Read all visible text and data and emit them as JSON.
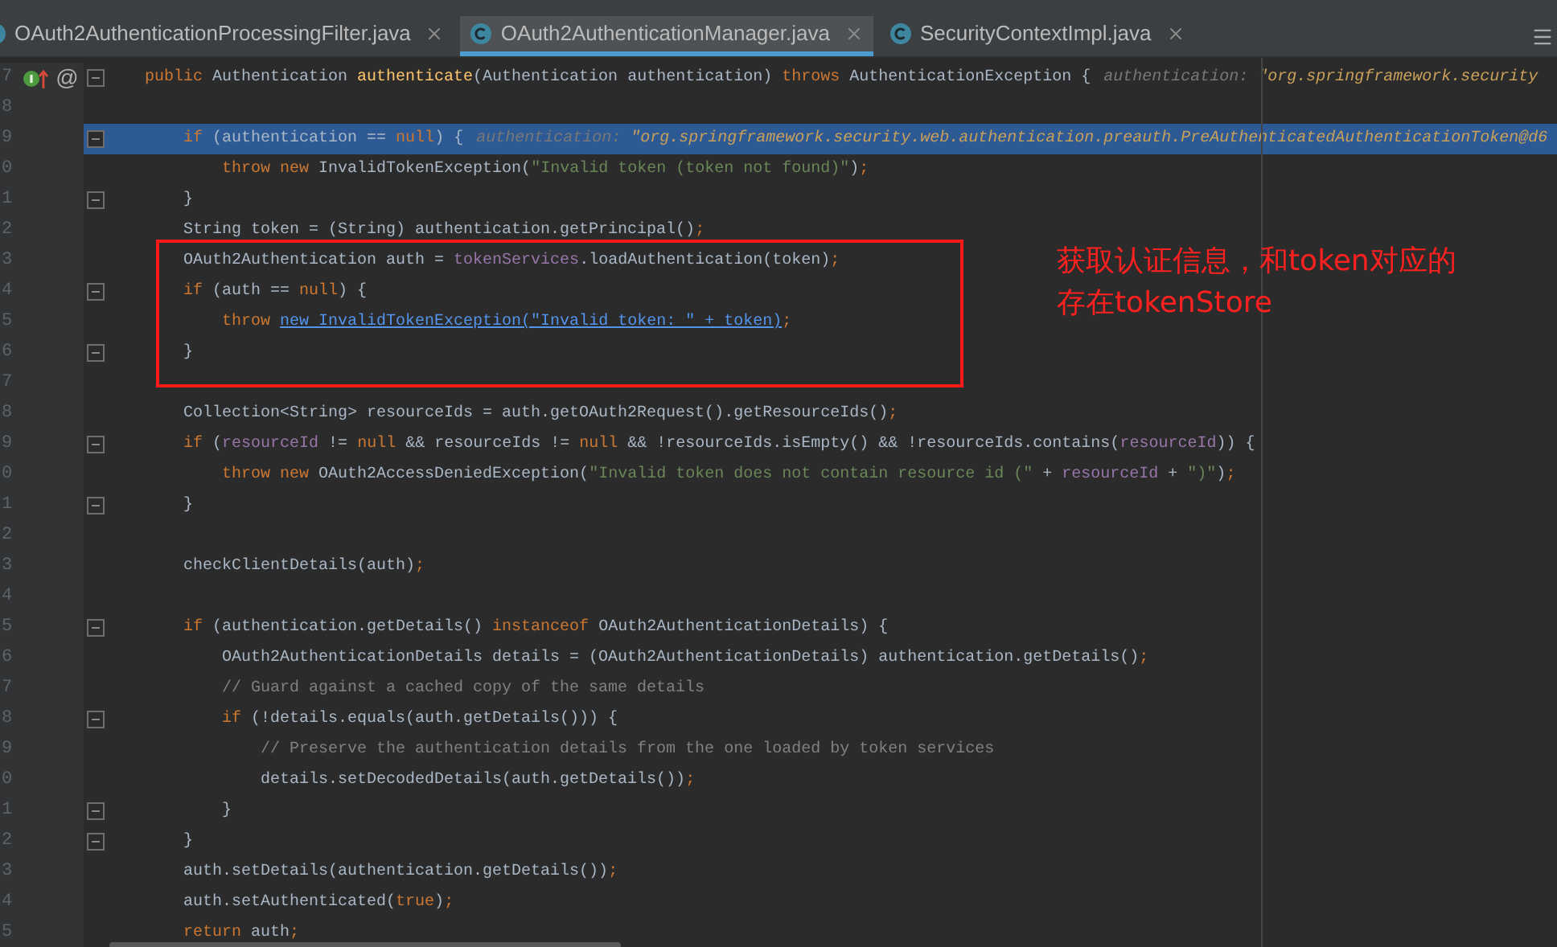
{
  "tabs": [
    {
      "label": "OAuth2AuthenticationProcessingFilter.java",
      "selected": false
    },
    {
      "label": "OAuth2AuthenticationManager.java",
      "selected": true
    },
    {
      "label": "SecurityContextImpl.java",
      "selected": false
    }
  ],
  "editor": {
    "lines": [
      {
        "number": "7",
        "highlighted": false,
        "fold": true,
        "gutter_mark": "@",
        "tokens": [
          {
            "text": "    public ",
            "kind": "kw"
          },
          {
            "text": "Authentication ",
            "kind": "plain"
          },
          {
            "text": "authenticate",
            "kind": "fn"
          },
          {
            "text": "(Authentication authentication) ",
            "kind": "plain"
          },
          {
            "text": "throws ",
            "kind": "kw"
          },
          {
            "text": "AuthenticationException {",
            "kind": "plain"
          },
          {
            "text": "authentication: ",
            "kind": "hint"
          },
          {
            "text": "\"org.springframework.security",
            "kind": "hintval"
          }
        ]
      },
      {
        "number": "8",
        "highlighted": false,
        "fold": false
      },
      {
        "number": "9",
        "highlighted": true,
        "fold": true,
        "tokens": [
          {
            "text": "        if ",
            "kind": "kw"
          },
          {
            "text": "(authentication == ",
            "kind": "plain"
          },
          {
            "text": "null",
            "kind": "kw"
          },
          {
            "text": ") {",
            "kind": "plain"
          },
          {
            "text": "authentication: ",
            "kind": "hint"
          },
          {
            "text": "\"org.springframework.security.web.authentication.preauth.PreAuthenticatedAuthenticationToken@d6",
            "kind": "hintval"
          }
        ]
      },
      {
        "number": "0",
        "highlighted": false,
        "fold": false,
        "tokens": [
          {
            "text": "            throw new ",
            "kind": "kw"
          },
          {
            "text": "InvalidTokenException(",
            "kind": "plain"
          },
          {
            "text": "\"Invalid token (token not found)\"",
            "kind": "str"
          },
          {
            "text": ")",
            "kind": "plain"
          },
          {
            "text": ";",
            "kind": "kw"
          }
        ]
      },
      {
        "number": "1",
        "highlighted": false,
        "fold": true,
        "tokens": [
          {
            "text": "        }",
            "kind": "plain"
          }
        ]
      },
      {
        "number": "2",
        "highlighted": false,
        "fold": false,
        "tokens": [
          {
            "text": "        String token = (String) authentication.getPrincipal()",
            "kind": "plain"
          },
          {
            "text": ";",
            "kind": "kw"
          }
        ]
      },
      {
        "number": "3",
        "highlighted": false,
        "fold": false,
        "tokens": [
          {
            "text": "        OAuth2Authentication auth = ",
            "kind": "plain"
          },
          {
            "text": "tokenServices",
            "kind": "field"
          },
          {
            "text": ".loadAuthentication(token)",
            "kind": "plain"
          },
          {
            "text": ";",
            "kind": "kw"
          }
        ]
      },
      {
        "number": "4",
        "highlighted": false,
        "fold": true,
        "tokens": [
          {
            "text": "        if ",
            "kind": "kw"
          },
          {
            "text": "(auth == ",
            "kind": "plain"
          },
          {
            "text": "null",
            "kind": "kw"
          },
          {
            "text": ") {",
            "kind": "plain"
          }
        ]
      },
      {
        "number": "5",
        "highlighted": false,
        "fold": false,
        "tokens": [
          {
            "text": "            throw ",
            "kind": "kw"
          },
          {
            "text": "new InvalidTokenException(\"Invalid token: \" + token)",
            "kind": "link"
          },
          {
            "text": ";",
            "kind": "kw"
          }
        ]
      },
      {
        "number": "6",
        "highlighted": false,
        "fold": true,
        "tokens": [
          {
            "text": "        }",
            "kind": "plain"
          }
        ]
      },
      {
        "number": "7",
        "highlighted": false,
        "fold": false
      },
      {
        "number": "8",
        "highlighted": false,
        "fold": false,
        "tokens": [
          {
            "text": "        Collection<String> resourceIds = auth.getOAuth2Request().getResourceIds()",
            "kind": "plain"
          },
          {
            "text": ";",
            "kind": "kw"
          }
        ]
      },
      {
        "number": "9",
        "highlighted": false,
        "fold": true,
        "tokens": [
          {
            "text": "        if ",
            "kind": "kw"
          },
          {
            "text": "(",
            "kind": "plain"
          },
          {
            "text": "resourceId",
            "kind": "field"
          },
          {
            "text": " != ",
            "kind": "plain"
          },
          {
            "text": "null",
            "kind": "kw"
          },
          {
            "text": " && resourceIds != ",
            "kind": "plain"
          },
          {
            "text": "null",
            "kind": "kw"
          },
          {
            "text": " && !resourceIds.isEmpty() && !resourceIds.contains(",
            "kind": "plain"
          },
          {
            "text": "resourceId",
            "kind": "field"
          },
          {
            "text": ")) {",
            "kind": "plain"
          }
        ]
      },
      {
        "number": "0",
        "highlighted": false,
        "fold": false,
        "tokens": [
          {
            "text": "            throw new ",
            "kind": "kw"
          },
          {
            "text": "OAuth2AccessDeniedException(",
            "kind": "plain"
          },
          {
            "text": "\"Invalid token does not contain resource id (\"",
            "kind": "str"
          },
          {
            "text": " + ",
            "kind": "plain"
          },
          {
            "text": "resourceId",
            "kind": "field"
          },
          {
            "text": " + ",
            "kind": "plain"
          },
          {
            "text": "\")\"",
            "kind": "str"
          },
          {
            "text": ")",
            "kind": "plain"
          },
          {
            "text": ";",
            "kind": "kw"
          }
        ]
      },
      {
        "number": "1",
        "highlighted": false,
        "fold": true,
        "tokens": [
          {
            "text": "        }",
            "kind": "plain"
          }
        ]
      },
      {
        "number": "2",
        "highlighted": false,
        "fold": false
      },
      {
        "number": "3",
        "highlighted": false,
        "fold": false,
        "tokens": [
          {
            "text": "        checkClientDetails(auth)",
            "kind": "plain"
          },
          {
            "text": ";",
            "kind": "kw"
          }
        ]
      },
      {
        "number": "4",
        "highlighted": false,
        "fold": false
      },
      {
        "number": "5",
        "highlighted": false,
        "fold": true,
        "tokens": [
          {
            "text": "        if ",
            "kind": "kw"
          },
          {
            "text": "(authentication.getDetails() ",
            "kind": "plain"
          },
          {
            "text": "instanceof ",
            "kind": "kw"
          },
          {
            "text": "OAuth2AuthenticationDetails) {",
            "kind": "plain"
          }
        ]
      },
      {
        "number": "6",
        "highlighted": false,
        "fold": false,
        "tokens": [
          {
            "text": "            OAuth2AuthenticationDetails details = (OAuth2AuthenticationDetails) authentication.getDetails()",
            "kind": "plain"
          },
          {
            "text": ";",
            "kind": "kw"
          }
        ]
      },
      {
        "number": "7",
        "highlighted": false,
        "fold": false,
        "tokens": [
          {
            "text": "            // Guard against a cached copy of the same details",
            "kind": "comment"
          }
        ]
      },
      {
        "number": "8",
        "highlighted": false,
        "fold": true,
        "tokens": [
          {
            "text": "            if ",
            "kind": "kw"
          },
          {
            "text": "(!details.equals(auth.getDetails())) {",
            "kind": "plain"
          }
        ]
      },
      {
        "number": "9",
        "highlighted": false,
        "fold": false,
        "tokens": [
          {
            "text": "                // Preserve the authentication details from the one loaded by token services",
            "kind": "comment"
          }
        ]
      },
      {
        "number": "0",
        "highlighted": false,
        "fold": false,
        "tokens": [
          {
            "text": "                details.setDecodedDetails(auth.getDetails())",
            "kind": "plain"
          },
          {
            "text": ";",
            "kind": "kw"
          }
        ]
      },
      {
        "number": "1",
        "highlighted": false,
        "fold": true,
        "tokens": [
          {
            "text": "            }",
            "kind": "plain"
          }
        ]
      },
      {
        "number": "2",
        "highlighted": false,
        "fold": true,
        "tokens": [
          {
            "text": "        }",
            "kind": "plain"
          }
        ]
      },
      {
        "number": "3",
        "highlighted": false,
        "fold": false,
        "tokens": [
          {
            "text": "        auth.setDetails(authentication.getDetails())",
            "kind": "plain"
          },
          {
            "text": ";",
            "kind": "kw"
          }
        ]
      },
      {
        "number": "4",
        "highlighted": false,
        "fold": false,
        "tokens": [
          {
            "text": "        auth.setAuthenticated(",
            "kind": "plain"
          },
          {
            "text": "true",
            "kind": "kw"
          },
          {
            "text": ")",
            "kind": "plain"
          },
          {
            "text": ";",
            "kind": "kw"
          }
        ]
      },
      {
        "number": "5",
        "highlighted": false,
        "fold": false,
        "tokens": [
          {
            "text": "        return ",
            "kind": "kw"
          },
          {
            "text": "auth",
            "kind": "plain"
          },
          {
            "text": ";",
            "kind": "kw"
          }
        ]
      }
    ]
  },
  "annotation": {
    "lines": [
      "获取认证信息，和token对应的",
      "存在tokenStore"
    ]
  }
}
